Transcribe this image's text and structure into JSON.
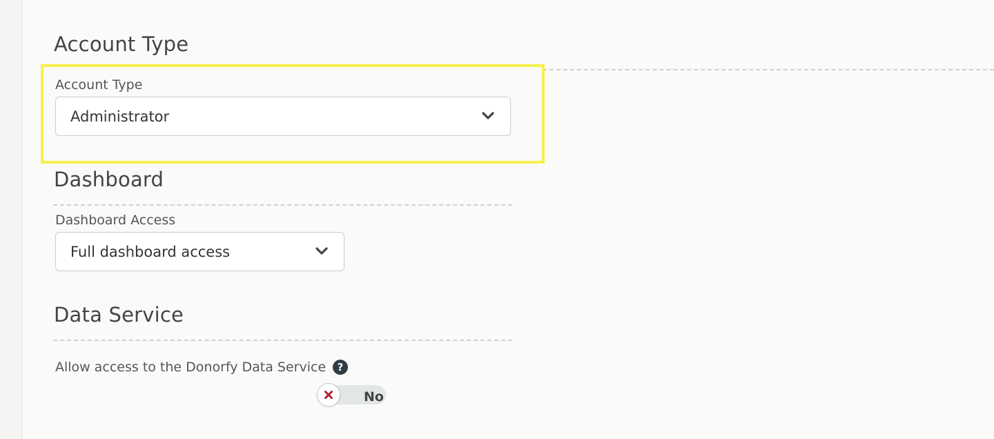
{
  "sections": {
    "account_type": {
      "title": "Account Type",
      "field_label": "Account Type",
      "selected_value": "Administrator"
    },
    "dashboard": {
      "title": "Dashboard",
      "field_label": "Dashboard Access",
      "selected_value": "Full dashboard access"
    },
    "data_service": {
      "title": "Data Service",
      "field_label": "Allow access to the Donorfy Data Service",
      "help_icon": "question-circle-icon",
      "toggle_label": "No",
      "toggle_state": "off"
    }
  },
  "colors": {
    "highlight": "#f7f04d",
    "toggle_off_mark": "#b0202e",
    "help_icon_bg": "#2f3c44"
  }
}
